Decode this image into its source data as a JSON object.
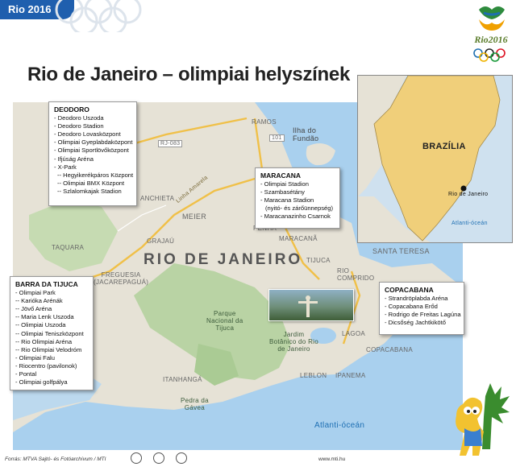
{
  "header": {
    "tag": "Rio 2016"
  },
  "title": "Rio de Janeiro – olimpiai helyszínek",
  "logo": {
    "text": "Rio2016"
  },
  "map": {
    "city_label": "RIO DE JANEIRO",
    "ocean_label": "Atlanti-óceán",
    "place_labels": {
      "ramos": "RAMOS",
      "ilha": "Ilha do\nFundão",
      "meier": "MEIER",
      "taquara": "TAQUARA",
      "maracana": "MARACANÃ",
      "santa_teresa": "SANTA TERESA",
      "freguesia": "FREGUESIA\n(JACAREPAGUÁ)",
      "parque": "Parque\nNacional da\nTijuca",
      "jardim": "Jardim\nBotânico do Rio\nde Janeiro",
      "lagoa": "LAGOA",
      "copacabana": "COPACABANA",
      "leblon": "LEBLON",
      "ipanema": "IPANEMA",
      "itanhanga": "ITANHANGÁ",
      "pedra": "Pedra da\nGávea",
      "tijuca": "TIJUCA",
      "rio_comprido": "RIO\nCOMPRIDO",
      "penha": "PENHA",
      "grajau": "GRAJAÚ",
      "anchieta": "ANCHIETA",
      "road_rj": "RJ-083",
      "road_101": "101",
      "linha": "Linha Amarela"
    }
  },
  "venues": {
    "deodoro": {
      "title": "DEODORO",
      "items": [
        "- Deodoro Uszoda",
        "- Deodoro Stadion",
        "- Deodoro Lovasközpont",
        "- Olimpiai Gyeplabdaközpont",
        "- Olimpiai Sportlövőközpont",
        "- Ifjúság Aréna",
        "- X-Park",
        "-- Hegyikerékpáros Központ",
        "-- Olimpiai BMX Központ",
        "-- Szlalomkajak Stadion"
      ]
    },
    "maracana": {
      "title": "MARACANA",
      "items": [
        "- Olimpiai Stadion",
        "- Szambasétány",
        "- Maracana Stadion",
        "(nyitó- és zárőünnepség)",
        "- Maracanazinho Csarnok"
      ]
    },
    "barra": {
      "title": "BARRA DA TIJUCA",
      "items": [
        "- Olimpiai Park",
        "-- Karióka Arénák",
        "-- Jövő Aréna",
        "-- Maria Lenk Uszoda",
        "-- Olimpiai Uszoda",
        "-- Olimpiai Teniszközpont",
        "-- Rio Olimpiai Aréna",
        "-- Rio Olimpiai Velodróm",
        "- Olimpiai Falu",
        "- Riocentro (pavilonok)",
        "- Pontal",
        "- Olimpiai golfpálya"
      ]
    },
    "copacabana": {
      "title": "COPACABANA",
      "items": [
        "- Strandröplabda Aréna",
        "- Copacabana Erőd",
        "- Rodrigo de Freitas Lagúna",
        "- Dicsőség Jachtkikötő"
      ]
    }
  },
  "inset": {
    "country": "BRAZÍLIA",
    "city": "Rio de Janeiro",
    "ocean": "Atlanti-óceán"
  },
  "footer": {
    "source": "Forrás: MTVA Sajtó- és Fotóarchívum / MTI",
    "url": "www.mti.hu"
  },
  "colors": {
    "header_blue": "#1f5fae",
    "brazil": "#f0cf7a",
    "land": "#e6e2d6",
    "sea": "#a9d0ee",
    "park": "#b9d3a4"
  }
}
